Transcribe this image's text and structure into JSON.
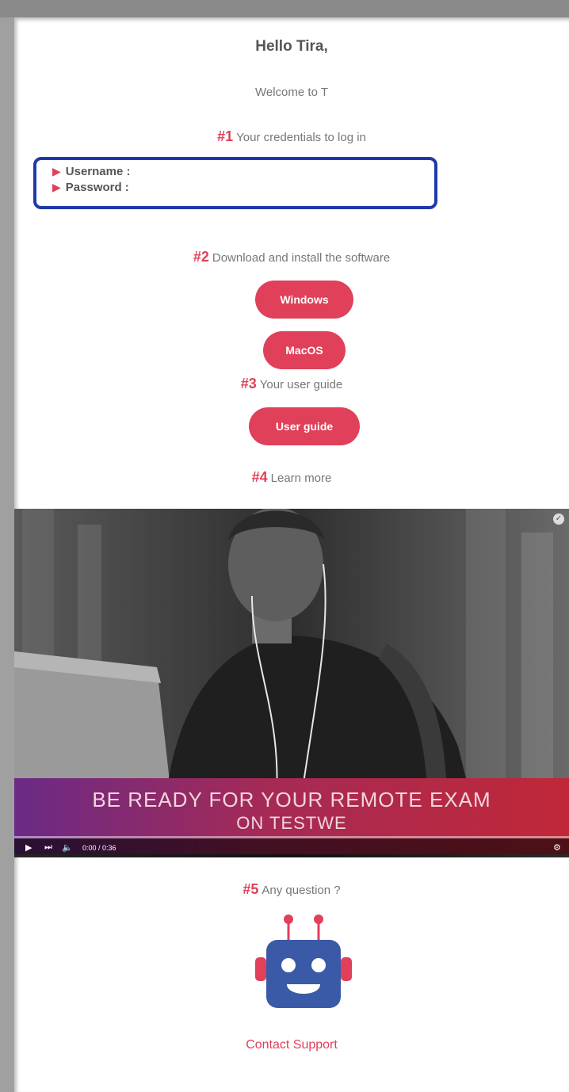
{
  "greeting": "Hello Tira,",
  "welcome": "Welcome to T",
  "steps": [
    {
      "num": "#1",
      "text": "Your credentials to log in"
    },
    {
      "num": "#2",
      "text": "Download and install the software"
    },
    {
      "num": "#3",
      "text": "Your user guide"
    },
    {
      "num": "#4",
      "text": "Learn more"
    },
    {
      "num": "#5",
      "text": "Any question ?"
    }
  ],
  "credentials": {
    "username_label": "Username :",
    "password_label": "Password :"
  },
  "buttons": {
    "windows": "Windows",
    "macos": "MacOS",
    "user_guide": "User guide"
  },
  "video": {
    "caption_line1": "BE READY FOR YOUR REMOTE EXAM",
    "caption_line2": "ON TESTWE",
    "time": "0:00 / 0:36"
  },
  "contact_label": "Contact Support",
  "colors": {
    "accent": "#e0405a",
    "highlight_border": "#1f3aa8",
    "robot_body": "#3a5aa8"
  },
  "icons": [
    "play-icon",
    "skip-icon",
    "volume-icon",
    "settings-icon",
    "robot-icon"
  ]
}
